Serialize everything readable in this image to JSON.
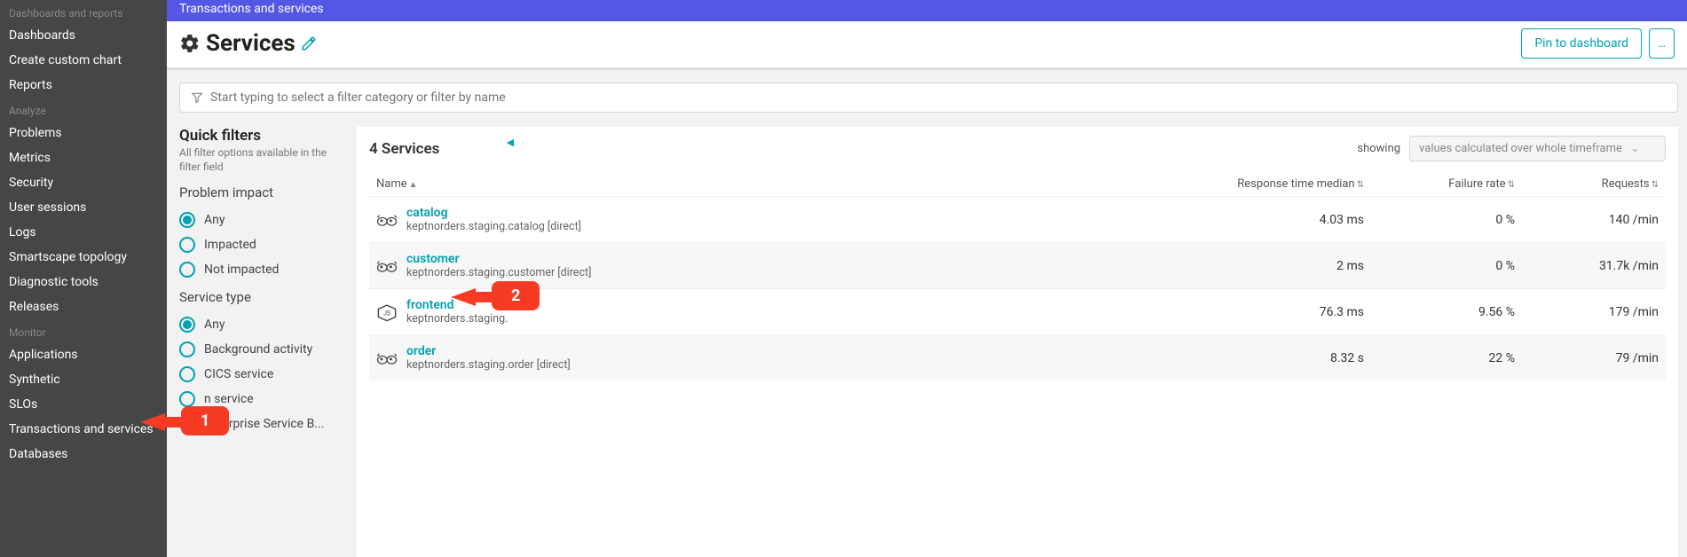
{
  "sidebar": {
    "group1_title": "Dashboards and reports",
    "group1": [
      "Dashboards",
      "Create custom chart",
      "Reports"
    ],
    "group2_title": "Analyze",
    "group2": [
      "Problems",
      "Metrics",
      "Security",
      "User sessions",
      "Logs",
      "Smartscape topology",
      "Diagnostic tools",
      "Releases"
    ],
    "group3_title": "Monitor",
    "group3": [
      "Applications",
      "Synthetic",
      "SLOs",
      "Transactions and services",
      "Databases"
    ]
  },
  "topbar": {
    "breadcrumb": "Transactions and services"
  },
  "header": {
    "title": "Services",
    "pin_label": "Pin to dashboard",
    "more_label": "…"
  },
  "filter_input": {
    "placeholder": "Start typing to select a filter category or filter by name"
  },
  "quick_filters": {
    "title": "Quick filters",
    "subtitle": "All filter options available in the filter field",
    "groups": [
      {
        "title": "Problem impact",
        "options": [
          "Any",
          "Impacted",
          "Not impacted"
        ],
        "selected": 0
      },
      {
        "title": "Service type",
        "options": [
          "Any",
          "Background activity",
          "CICS service",
          "n service",
          "Enterprise Service B..."
        ],
        "selected": 0
      }
    ]
  },
  "services": {
    "count_label": "4 Services",
    "showing_label": "showing",
    "showing_value": "values calculated over whole timeframe",
    "columns": {
      "name": "Name",
      "rt": "Response time median",
      "fail": "Failure rate",
      "req": "Requests"
    },
    "rows": [
      {
        "name": "catalog",
        "sub": "keptnorders.staging.catalog [direct]",
        "rt": "4.03 ms",
        "fail": "0 %",
        "req": "140 /min",
        "icon": "go"
      },
      {
        "name": "customer",
        "sub": "keptnorders.staging.customer [direct]",
        "rt": "2 ms",
        "fail": "0 %",
        "req": "31.7k /min",
        "icon": "go"
      },
      {
        "name": "frontend",
        "sub": "keptnorders.staging.",
        "rt": "76.3 ms",
        "fail": "9.56 %",
        "req": "179 /min",
        "icon": "js"
      },
      {
        "name": "order",
        "sub": "keptnorders.staging.order [direct]",
        "rt": "8.32 s",
        "fail": "22 %",
        "req": "79 /min",
        "icon": "go"
      }
    ]
  },
  "annotations": [
    {
      "num": "1",
      "target": "sidebar-item-transactions"
    },
    {
      "num": "2",
      "target": "service-frontend"
    }
  ]
}
